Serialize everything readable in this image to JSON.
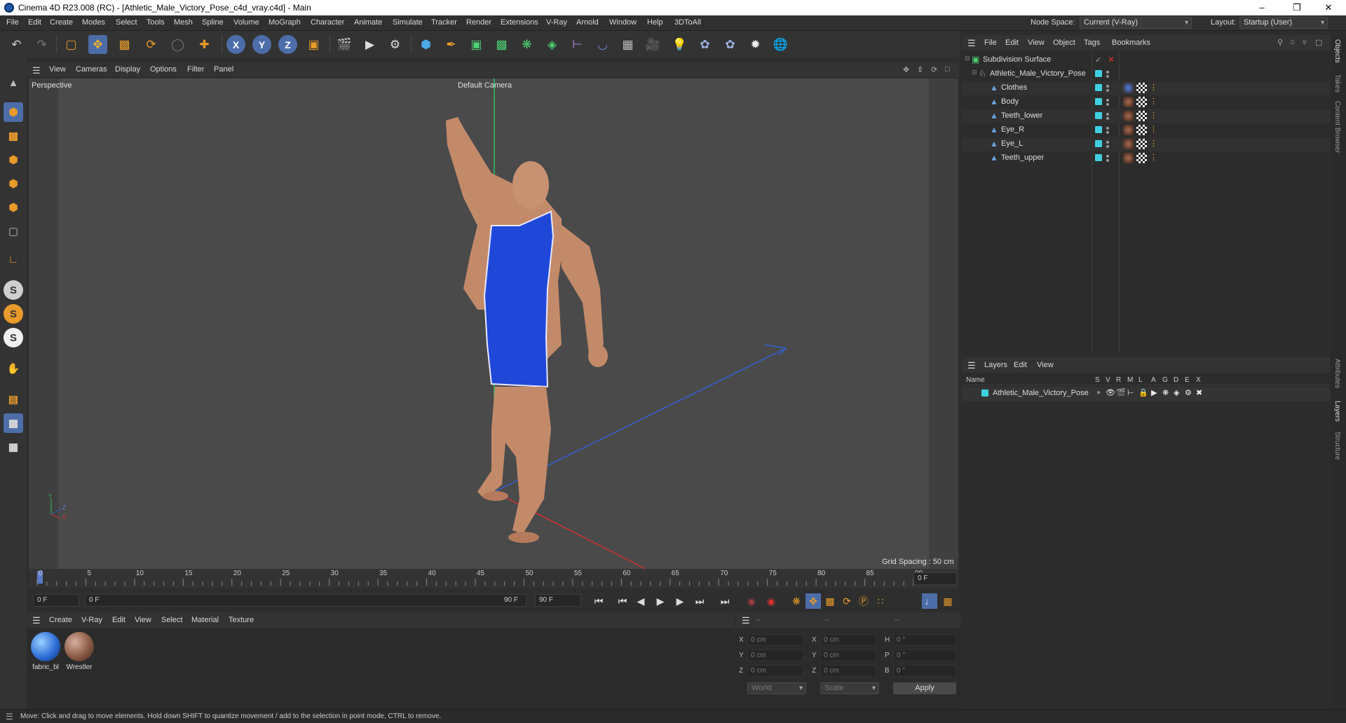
{
  "window": {
    "title": "Cinema 4D R23.008 (RC) - [Athletic_Male_Victory_Pose_c4d_vray.c4d] - Main"
  },
  "menu": [
    "File",
    "Edit",
    "Create",
    "Modes",
    "Select",
    "Tools",
    "Mesh",
    "Spline",
    "Volume",
    "MoGraph",
    "Character",
    "Animate",
    "Simulate",
    "Tracker",
    "Render",
    "Extensions",
    "V-Ray",
    "Arnold",
    "Window",
    "Help",
    "3DToAll"
  ],
  "node_space": {
    "label": "Node Space:",
    "value": "Current (V-Ray)"
  },
  "layout": {
    "label": "Layout:",
    "value": "Startup (User)"
  },
  "viewport": {
    "menu": [
      "View",
      "Cameras",
      "Display",
      "Options",
      "Filter",
      "Panel"
    ],
    "projection": "Perspective",
    "camera": "Default Camera",
    "grid_spacing": "Grid Spacing : 50 cm",
    "axis": {
      "y": "Y",
      "z": "Z",
      "x": "X"
    }
  },
  "timeline": {
    "ticks": [
      "0",
      "5",
      "10",
      "15",
      "20",
      "25",
      "30",
      "35",
      "40",
      "45",
      "50",
      "55",
      "60",
      "65",
      "70",
      "75",
      "80",
      "85",
      "90"
    ],
    "current_frame": "0 F"
  },
  "transport": {
    "start": "0 F",
    "range_start": "0 F",
    "range_end": "90 F",
    "end": "90 F"
  },
  "materials": {
    "menu": [
      "Create",
      "V-Ray",
      "Edit",
      "View",
      "Select",
      "Material",
      "Texture"
    ],
    "items": [
      {
        "name": "fabric_bl",
        "color": "#2f6fd8"
      },
      {
        "name": "Wrestler",
        "color": "#8a5a44"
      }
    ]
  },
  "coords": {
    "headers": [
      "--",
      "--",
      "--"
    ],
    "rows": [
      {
        "a": "X",
        "av": "0 cm",
        "b": "X",
        "bv": "0 cm",
        "c": "H",
        "cv": "0 °"
      },
      {
        "a": "Y",
        "av": "0 cm",
        "b": "Y",
        "bv": "0 cm",
        "c": "P",
        "cv": "0 °"
      },
      {
        "a": "Z",
        "av": "0 cm",
        "b": "Z",
        "bv": "0 cm",
        "c": "B",
        "cv": "0 °"
      }
    ],
    "space": "World",
    "mode": "Scale",
    "apply": "Apply"
  },
  "objects": {
    "menu": [
      "File",
      "Edit",
      "View",
      "Object",
      "Tags",
      "Bookmarks"
    ],
    "tree": [
      {
        "name": "Subdivision Surface",
        "level": 0
      },
      {
        "name": "Athletic_Male_Victory_Pose",
        "level": 1
      },
      {
        "name": "Clothes",
        "level": 2
      },
      {
        "name": "Body",
        "level": 2
      },
      {
        "name": "Teeth_lower",
        "level": 2
      },
      {
        "name": "Eye_R",
        "level": 2
      },
      {
        "name": "Eye_L",
        "level": 2
      },
      {
        "name": "Teeth_upper",
        "level": 2
      }
    ]
  },
  "layers": {
    "menu": [
      "Layers",
      "Edit",
      "View"
    ],
    "columns": [
      "Name",
      "S",
      "V",
      "R",
      "M",
      "L",
      "A",
      "G",
      "D",
      "E",
      "X"
    ],
    "items": [
      {
        "name": "Athletic_Male_Victory_Pose"
      }
    ]
  },
  "side_tabs": [
    "Objects",
    "Takes",
    "Content Browser",
    "Attributes",
    "Layers",
    "Structure"
  ],
  "status": "Move: Click and drag to move elements. Hold down SHIFT to quantize movement / add to the selection in point mode, CTRL to remove.",
  "colors": {
    "accent": "#3fd0e0",
    "x_axis": "#d03030",
    "y_axis": "#30c060",
    "z_axis": "#3060d0"
  }
}
